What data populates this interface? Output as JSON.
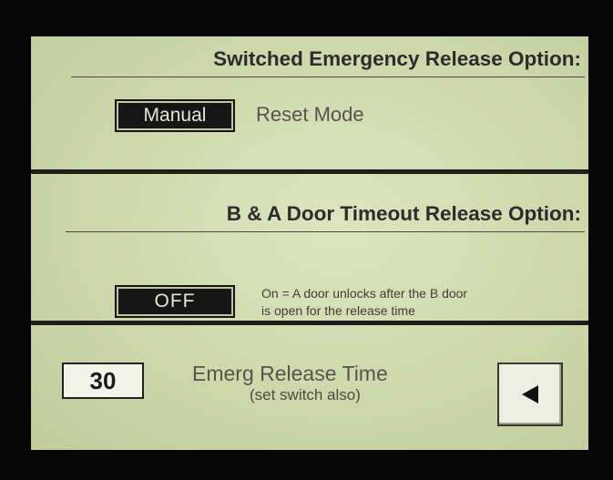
{
  "emergency_release": {
    "title": "Switched Emergency Release Option:",
    "mode_button": "Manual",
    "mode_label": "Reset Mode"
  },
  "door_timeout": {
    "title": "B & A Door Timeout Release Option:",
    "toggle_button": "OFF",
    "description_line1": "On = A door unlocks after the B door",
    "description_line2": "is open for the release time"
  },
  "release_time": {
    "value": "30",
    "label": "Emerg Release Time",
    "sublabel": "(set switch also)",
    "back_icon": "left-triangle-icon"
  },
  "colors": {
    "screen_bg": "#d2dbb0",
    "bezel": "#050505",
    "button_dark": "#161616",
    "divider": "#1e1e1a"
  }
}
